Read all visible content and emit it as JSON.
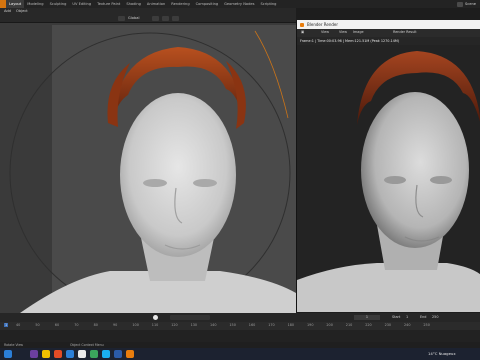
{
  "workspace_tabs": [
    "Layout",
    "Modeling",
    "Sculpting",
    "UV Editing",
    "Texture Paint",
    "Shading",
    "Animation",
    "Rendering",
    "Compositing",
    "Geometry Nodes",
    "Scripting"
  ],
  "active_workspace_index": 0,
  "scene_label": "Scene",
  "viewport_header": {
    "mode": "Add",
    "menu_object": "Object",
    "transform_orientation": "Global"
  },
  "render_window": {
    "title": "Blender Render",
    "menus": [
      "View",
      "View",
      "Image"
    ],
    "slot": "Slot 1",
    "layer": "Render Result",
    "info": "Frame:1 | Time:00:03.96 | Mem:121.51M (Peak 1270.14M)"
  },
  "timeline": {
    "current_frame": "1",
    "start_label": "Start",
    "start_value": "1",
    "end_label": "End",
    "end_value": "250",
    "ruler_ticks": [
      "40",
      "50",
      "60",
      "70",
      "80",
      "90",
      "100",
      "110",
      "120",
      "130",
      "140",
      "150",
      "160",
      "170",
      "180",
      "190",
      "200",
      "210",
      "220",
      "230",
      "240",
      "250"
    ]
  },
  "status_bar": {
    "left_hint": "Rotate View",
    "right_hint": "Object Context Menu"
  },
  "taskbar": {
    "weather": "14°C  Nuageux"
  },
  "colors": {
    "accent": "#e87d0d",
    "active_tab": "#3b3b3b",
    "taskbar": "#1c2230"
  }
}
